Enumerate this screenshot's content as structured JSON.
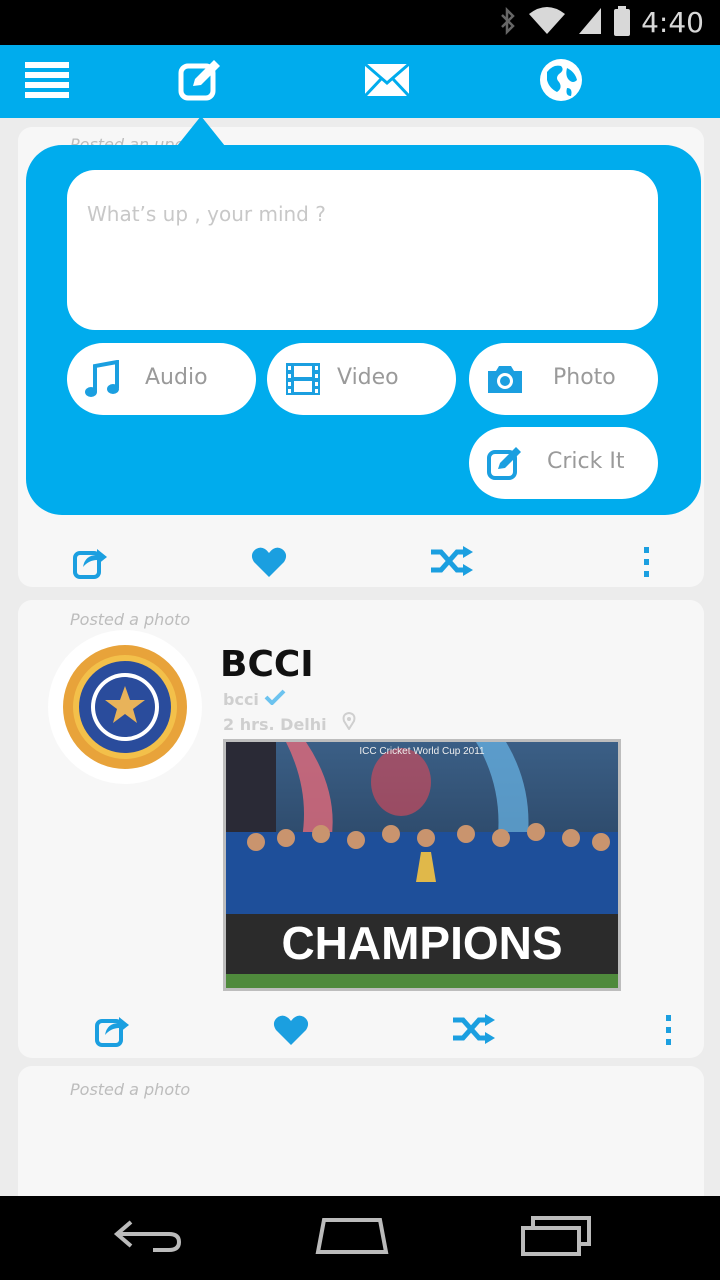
{
  "status_bar": {
    "time": "4:40",
    "icons": [
      "bluetooth-icon",
      "wifi-icon",
      "signal-icon",
      "battery-icon"
    ]
  },
  "app_bar": {
    "items": [
      {
        "name": "menu-icon"
      },
      {
        "name": "compose-icon",
        "active": true
      },
      {
        "name": "mail-icon"
      },
      {
        "name": "globe-icon"
      }
    ],
    "color": "#00aced"
  },
  "composer": {
    "hidden_label": "Posted an update",
    "placeholder": "What’s up , your mind ?",
    "buttons": {
      "audio": "Audio",
      "video": "Video",
      "photo": "Photo",
      "crick_it": "Crick It"
    }
  },
  "posts": [
    {
      "label": "Posted a photo",
      "title": "BCCI",
      "handle": "bcci",
      "verified": true,
      "meta": "2 hrs. Delhi",
      "image_banner": "CHAMPIONS",
      "image_header": "ICC Cricket World Cup 2011"
    },
    {
      "label": "Posted a photo"
    }
  ],
  "colors": {
    "accent": "#00aced",
    "card": "#f7f7f7",
    "background": "#ececec"
  }
}
